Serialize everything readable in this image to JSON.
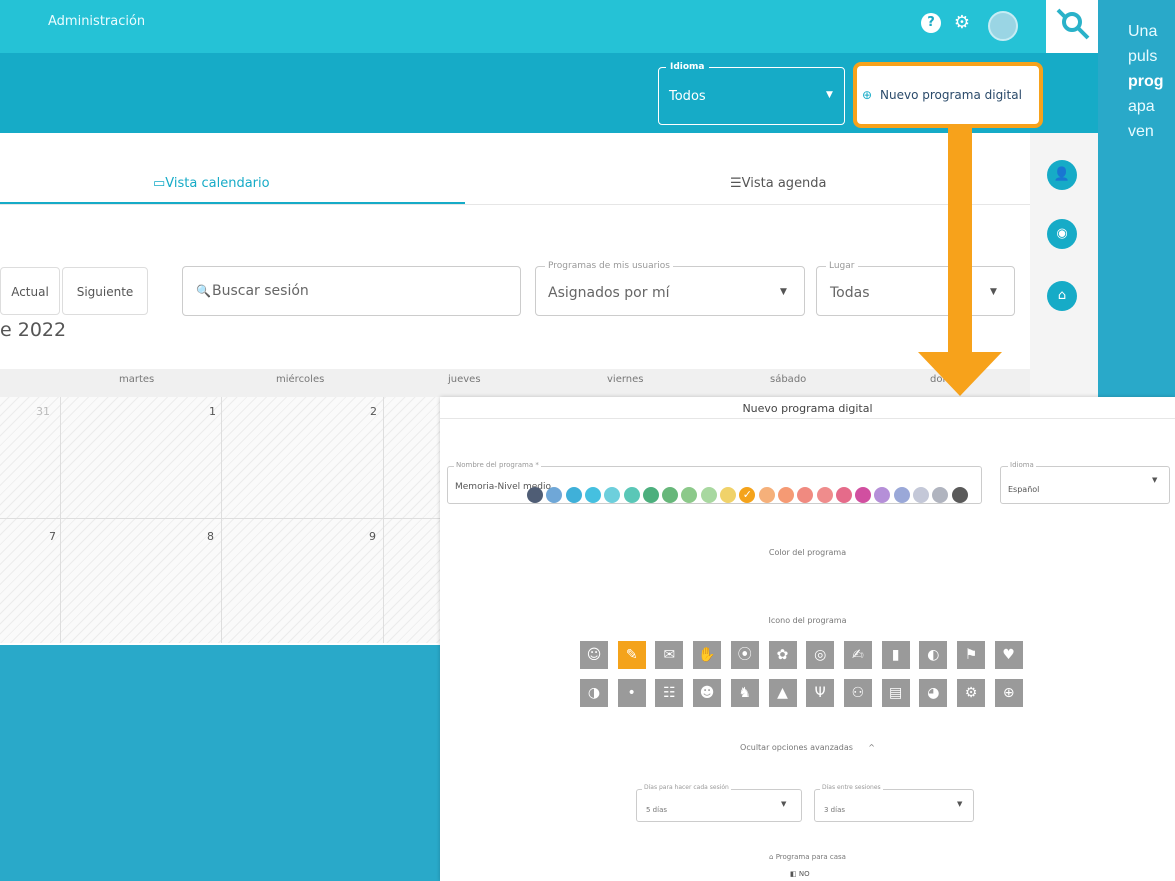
{
  "topbar": {
    "title": "Administración",
    "help_icon": "?",
    "settings_icon": "⚙"
  },
  "header": {
    "idioma_label": "Idioma",
    "idioma_value": "Todos",
    "new_button_label": "Nuevo programa digital"
  },
  "tabs": [
    {
      "label": "Vista calendario"
    },
    {
      "label": "Vista agenda"
    }
  ],
  "toolbar": {
    "actual": "Actual",
    "siguiente": "Siguiente",
    "search_placeholder": "Buscar sesión",
    "programas_label": "Programas de mis usuarios",
    "programas_value": "Asignados por mí",
    "lugar_label": "Lugar",
    "lugar_value": "Todas"
  },
  "calendar": {
    "month_title": "e 2022",
    "days": [
      "martes",
      "miércoles",
      "jueves",
      "viernes",
      "sábado",
      "dom"
    ],
    "row1": [
      "31",
      "1",
      "2"
    ],
    "row2": [
      "7",
      "8",
      "9"
    ]
  },
  "caption": {
    "line1": "Una",
    "line2": "puls",
    "line3_bold": "prog",
    "line4": "apa",
    "line5": "ven"
  },
  "modal": {
    "title": "Nuevo programa digital",
    "nombre_label": "Nombre del programa *",
    "nombre_value": "Memoria-Nivel medio",
    "idioma_label": "Idioma",
    "idioma_value": "Español",
    "color_label": "Color del programa",
    "colors": [
      "#4f5d75",
      "#6fa7d7",
      "#3fb0d9",
      "#45c0e0",
      "#6dcfdc",
      "#5ac7b7",
      "#4caf7d",
      "#67b77a",
      "#8cc98a",
      "#a8d8a0",
      "#f0d26a",
      "#f4a31b",
      "#f5b07a",
      "#f59a74",
      "#f08a80",
      "#ef8c8c",
      "#e56b8a",
      "#d14fa0",
      "#b58fd8",
      "#9aa8d8",
      "#c4c8d8",
      "#b0b4bf",
      "#5a5a5a"
    ],
    "icon_label": "Icono del programa",
    "icons_row1": [
      "person-icon",
      "idea-icon",
      "chat-icon",
      "hand-icon",
      "brain-icon",
      "brain-gear-icon",
      "eye-icon",
      "arm-icon",
      "chart-icon",
      "ear-icon",
      "sign-icon",
      "heart-icon"
    ],
    "icons_row2": [
      "ear-alt-icon",
      "bubble-icon",
      "handshake-icon",
      "head-icon",
      "walk-icon",
      "podium-icon",
      "fork-icon",
      "people-icon",
      "clipboard-icon",
      "speech-icon",
      "head-gear-icon",
      "target-icon"
    ],
    "advanced_label": "Ocultar opciones avanzadas",
    "dias_label": "Días para hacer cada sesión",
    "dias_value": "5 días",
    "entre_label": "Días entre sesiones",
    "entre_value": "3 días",
    "casa_label": "Programa para casa",
    "casa_value": "NO"
  }
}
